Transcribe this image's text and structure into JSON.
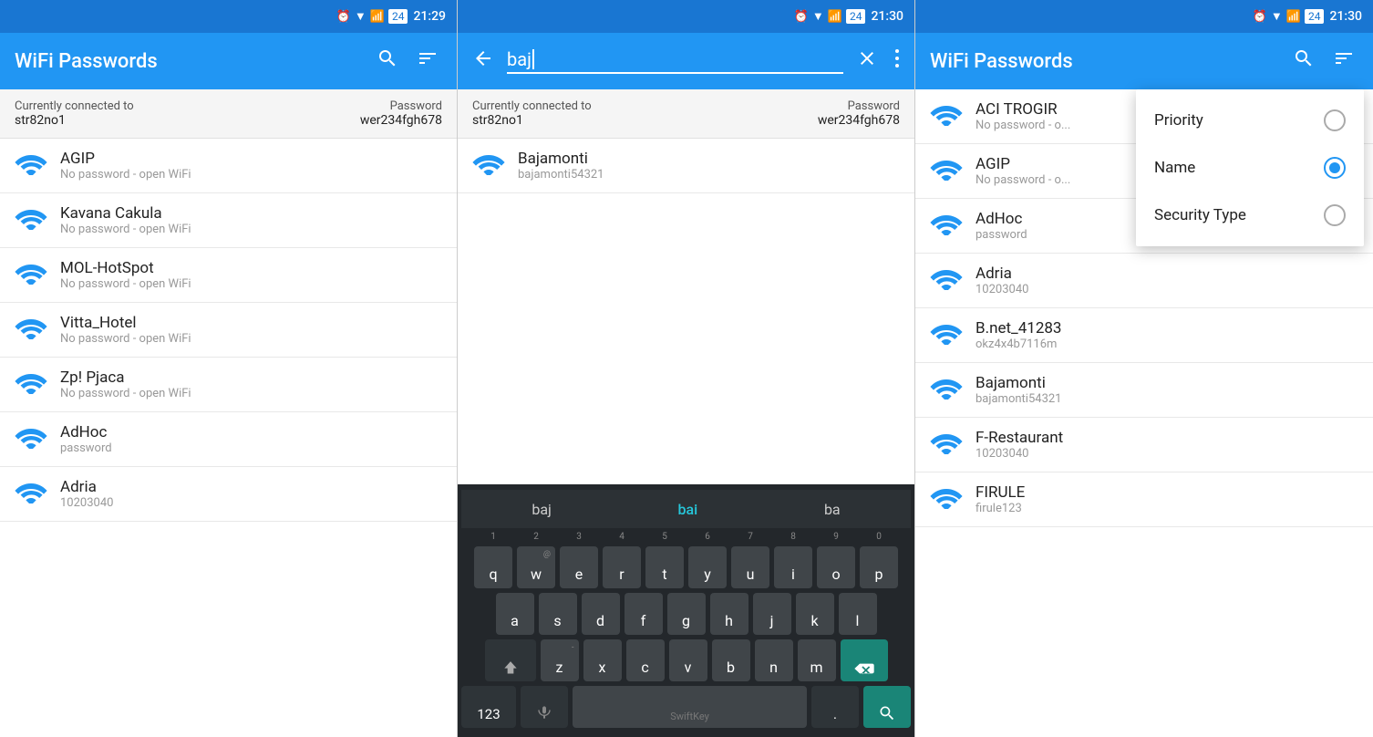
{
  "panel1": {
    "statusTime": "21:29",
    "title": "WiFi Passwords",
    "searchLabel": "🔍",
    "filterLabel": "≡",
    "connectedLabel": "Currently connected to",
    "connectedNetwork": "str82no1",
    "passwordLabel": "Password",
    "passwordValue": "wer234fgh678",
    "networks": [
      {
        "name": "AGIP",
        "sub": "No password - open WiFi"
      },
      {
        "name": "Kavana Cakula",
        "sub": "No password - open WiFi"
      },
      {
        "name": "MOL-HotSpot",
        "sub": "No password - open WiFi"
      },
      {
        "name": "Vitta_Hotel",
        "sub": "No password - open WiFi"
      },
      {
        "name": "Zp! Pjaca",
        "sub": "No password - open WiFi"
      },
      {
        "name": "AdHoc",
        "sub": "password"
      },
      {
        "name": "Adria",
        "sub": "10203040"
      }
    ]
  },
  "panel2": {
    "statusTime": "21:30",
    "searchText": "baj",
    "connectedLabel": "Currently connected to",
    "connectedNetwork": "str82no1",
    "passwordLabel": "Password",
    "passwordValue": "wer234fgh678",
    "results": [
      {
        "name": "Bajamonti",
        "sub": "bajamonti54321"
      }
    ],
    "keyboard": {
      "suggestions": [
        "baj",
        "bai",
        "ba"
      ],
      "highlightIndex": 1,
      "rows": [
        [
          "q",
          "w",
          "e",
          "r",
          "t",
          "y",
          "u",
          "i",
          "o",
          "p"
        ],
        [
          "a",
          "s",
          "d",
          "f",
          "g",
          "h",
          "j",
          "k",
          "l"
        ],
        [
          "z",
          "x",
          "c",
          "v",
          "b",
          "n",
          "m"
        ]
      ],
      "numRow": [
        "1",
        "2",
        "3",
        "4",
        "5",
        "6",
        "7",
        "8",
        "9",
        "0"
      ],
      "subSymbols": [
        "",
        "@",
        "#",
        "&",
        "*",
        "-",
        "+",
        "=",
        "(",
        ")",
        ")"
      ]
    }
  },
  "panel3": {
    "statusTime": "21:30",
    "title": "WiFi Passwords",
    "searchLabel": "🔍",
    "filterLabel": "≡",
    "networks": [
      {
        "name": "ACI TROGIR",
        "sub": "No password - o..."
      },
      {
        "name": "AGIP",
        "sub": "No password - o..."
      },
      {
        "name": "AdHoc",
        "sub": "password"
      },
      {
        "name": "Adria",
        "sub": "10203040"
      },
      {
        "name": "B.net_41283",
        "sub": "okz4x4b7116m"
      },
      {
        "name": "Bajamonti",
        "sub": "bajamonti54321"
      },
      {
        "name": "F-Restaurant",
        "sub": "10203040"
      },
      {
        "name": "FIRULE",
        "sub": "firule123"
      }
    ],
    "dropdown": {
      "items": [
        {
          "label": "Priority",
          "selected": false
        },
        {
          "label": "Name",
          "selected": true
        },
        {
          "label": "Security Type",
          "selected": false
        }
      ]
    }
  }
}
